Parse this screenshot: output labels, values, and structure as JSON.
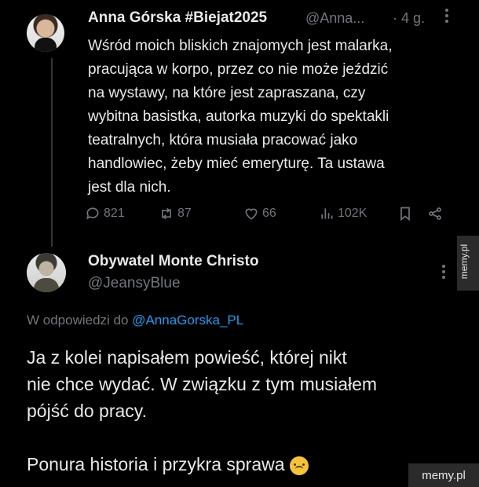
{
  "tweet1": {
    "author_name": "Anna Górska #Biejat2025",
    "handle": "@Anna...",
    "time": "· 4 g.",
    "text": "Wśród moich bliskich znajomych jest malarka,\npracująca w korpo, przez co nie może jeździć\nna wystawy, na które jest zapraszana, czy\nwybitna basistka, autorka muzyki do spektakli\nteatralnych, która musiała pracować jako\nhandlowiec, żeby mieć emeryturę. Ta ustawa\njest dla nich.",
    "stats": {
      "replies": "821",
      "retweets": "87",
      "likes": "66",
      "views": "102K"
    }
  },
  "tweet2": {
    "author_name": "Obywatel Monte Christo",
    "handle": "@JeansyBlue",
    "reply_prefix": "W odpowiedzi do",
    "reply_handle": "@AnnaGorska_PL",
    "text": "Ja z kolei napisałem powieść, której nikt\nnie chce wydać. W związku z tym musiałem\npójść do pracy.\n\nPonura historia i przykra sprawa"
  },
  "watermarks": {
    "side": "memy.pl",
    "bottom": "memy.pl"
  },
  "icons": {
    "reply": "reply-icon",
    "retweet": "retweet-icon",
    "like": "heart-icon",
    "views": "views-icon",
    "bookmark": "bookmark-icon",
    "share": "share-icon",
    "emoji": "upside-down-face-emoji"
  },
  "colors": {
    "background": "#000000",
    "text": "#e7e9ea",
    "muted": "#71767b",
    "link": "#1d9bf0"
  }
}
